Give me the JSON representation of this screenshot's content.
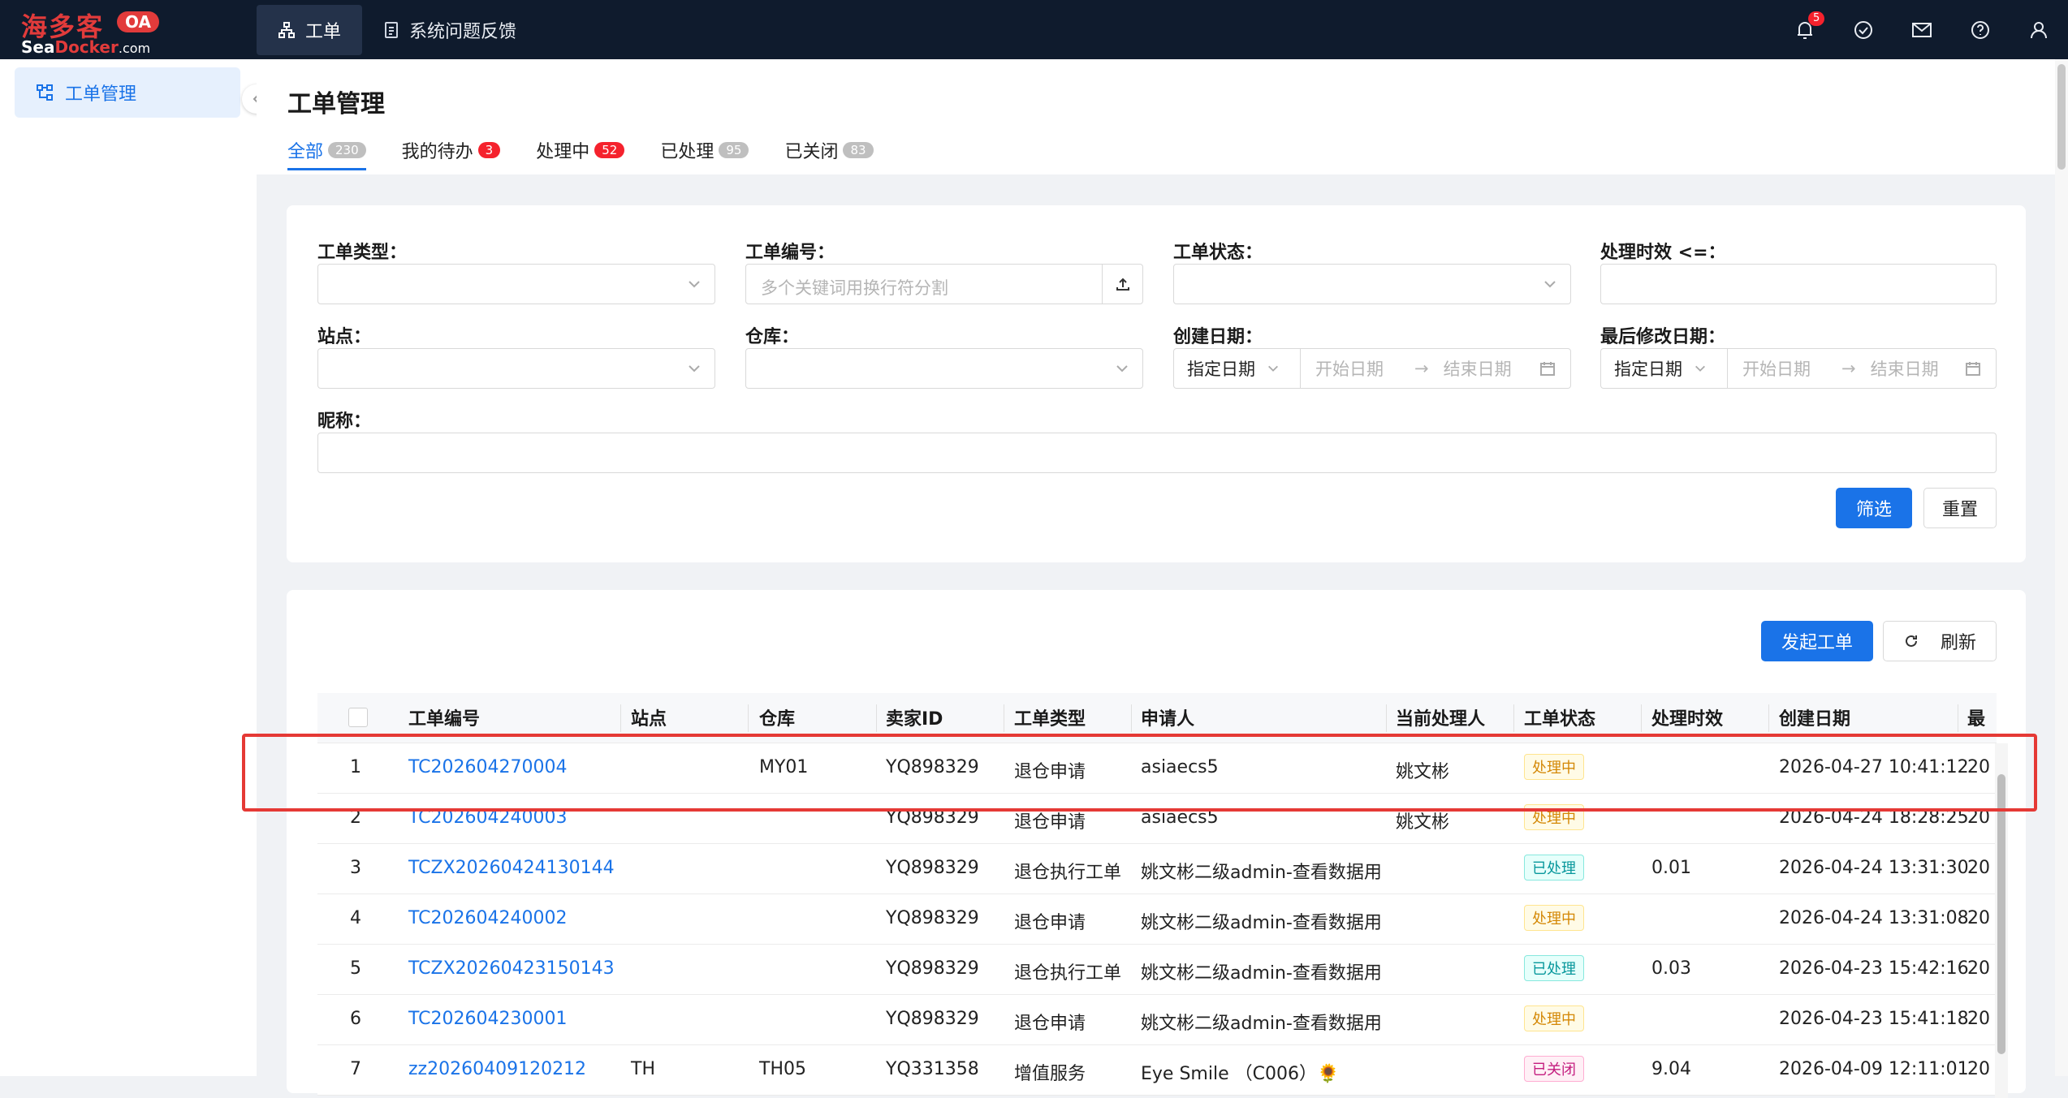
{
  "brand": {
    "cn": "海多客",
    "oa": "OA",
    "en_prefix": "Sea",
    "en_mid": "Docker",
    "en_suffix": ".com"
  },
  "topnav": [
    {
      "label": "工单",
      "icon": "sitemap-icon",
      "active": true
    },
    {
      "label": "系统问题反馈",
      "icon": "document-icon",
      "active": false
    }
  ],
  "top_icons": {
    "bell_badge": "5"
  },
  "sidebar": {
    "items": [
      {
        "label": "工单管理",
        "icon": "sitemap-icon",
        "active": true
      }
    ]
  },
  "page": {
    "title": "工单管理"
  },
  "tabs": [
    {
      "label": "全部",
      "count": "230",
      "style": "grey",
      "active": true
    },
    {
      "label": "我的待办",
      "count": "3",
      "style": "red",
      "active": false
    },
    {
      "label": "处理中",
      "count": "52",
      "style": "red",
      "active": false
    },
    {
      "label": "已处理",
      "count": "95",
      "style": "grey",
      "active": false
    },
    {
      "label": "已关闭",
      "count": "83",
      "style": "grey",
      "active": false
    }
  ],
  "filters": {
    "type_label": "工单类型：",
    "number_label": "工单编号：",
    "number_placeholder": "多个关键词用换行符分割",
    "status_label": "工单状态：",
    "duration_label": "处理时效 <=：",
    "site_label": "站点：",
    "warehouse_label": "仓库：",
    "created_label": "创建日期：",
    "modified_label": "最后修改日期：",
    "date_mode": "指定日期",
    "start_placeholder": "开始日期",
    "end_placeholder": "结束日期",
    "nickname_label": "昵称：",
    "filter_button": "筛选",
    "reset_button": "重置"
  },
  "actions": {
    "create_button": "发起工单",
    "refresh_button": "刷新"
  },
  "table": {
    "columns": [
      "工单编号",
      "站点",
      "仓库",
      "卖家ID",
      "工单类型",
      "申请人",
      "当前处理人",
      "工单状态",
      "处理时效",
      "创建日期",
      "最"
    ],
    "rows": [
      {
        "idx": "1",
        "no": "TC202604270004",
        "site": "",
        "wh": "MY01",
        "seller": "YQ898329",
        "type": "退仓申请",
        "applicant": "asiaecs5",
        "handler": "姚文彬",
        "status": "处理中",
        "status_kind": "processing",
        "duration": "",
        "created": "2026-04-27 10:41:12",
        "last": "20"
      },
      {
        "idx": "2",
        "no": "TC202604240003",
        "site": "",
        "wh": "",
        "seller": "YQ898329",
        "type": "退仓申请",
        "applicant": "asiaecs5",
        "handler": "姚文彬",
        "status": "处理中",
        "status_kind": "processing",
        "duration": "",
        "created": "2026-04-24 18:28:25",
        "last": "20"
      },
      {
        "idx": "3",
        "no": "TCZX20260424130144",
        "site": "",
        "wh": "",
        "seller": "YQ898329",
        "type": "退仓执行工单",
        "applicant": "姚文彬二级admin-查看数据用",
        "handler": "",
        "status": "已处理",
        "status_kind": "done",
        "duration": "0.01",
        "created": "2026-04-24 13:31:30",
        "last": "20"
      },
      {
        "idx": "4",
        "no": "TC202604240002",
        "site": "",
        "wh": "",
        "seller": "YQ898329",
        "type": "退仓申请",
        "applicant": "姚文彬二级admin-查看数据用",
        "handler": "",
        "status": "处理中",
        "status_kind": "processing",
        "duration": "",
        "created": "2026-04-24 13:31:08",
        "last": "20"
      },
      {
        "idx": "5",
        "no": "TCZX20260423150143",
        "site": "",
        "wh": "",
        "seller": "YQ898329",
        "type": "退仓执行工单",
        "applicant": "姚文彬二级admin-查看数据用",
        "handler": "",
        "status": "已处理",
        "status_kind": "done",
        "duration": "0.03",
        "created": "2026-04-23 15:42:16",
        "last": "20"
      },
      {
        "idx": "6",
        "no": "TC202604230001",
        "site": "",
        "wh": "",
        "seller": "YQ898329",
        "type": "退仓申请",
        "applicant": "姚文彬二级admin-查看数据用",
        "handler": "",
        "status": "处理中",
        "status_kind": "processing",
        "duration": "",
        "created": "2026-04-23 15:41:18",
        "last": "20"
      },
      {
        "idx": "7",
        "no": "zz20260409120212",
        "site": "TH",
        "wh": "TH05",
        "seller": "YQ331358",
        "type": "增值服务",
        "applicant": "Eye Smile （C006）🌻",
        "handler": "",
        "status": "已关闭",
        "status_kind": "closed",
        "duration": "9.04",
        "created": "2026-04-09 12:11:01",
        "last": "20"
      }
    ]
  },
  "colors": {
    "accent": "#1a73e8",
    "topbar": "#0f1b2d",
    "highlight": "#e53935"
  }
}
